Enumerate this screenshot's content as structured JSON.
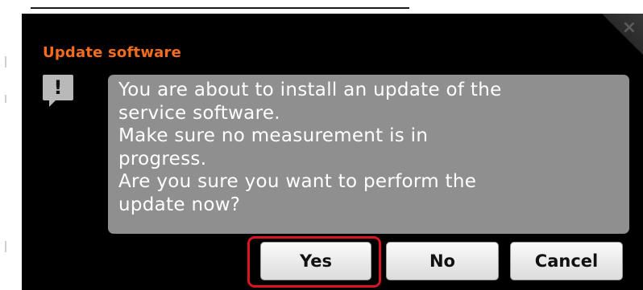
{
  "dialog": {
    "title": "Update software",
    "close_label": "×",
    "icon": "warning-exclamation-icon",
    "icon_glyph": "!",
    "message_lines": [
      "You are about to install an update of the",
      "service software.",
      "Make sure no measurement is in",
      "progress.",
      "Are you sure you want to perform the",
      "update now?"
    ]
  },
  "buttons": {
    "yes_label": "Yes",
    "no_label": "No",
    "cancel_label": "Cancel"
  },
  "colors": {
    "title": "#f46d1e",
    "dialog_bg": "#000000",
    "message_bg": "#8f8f8f",
    "highlight": "#d8161f"
  }
}
